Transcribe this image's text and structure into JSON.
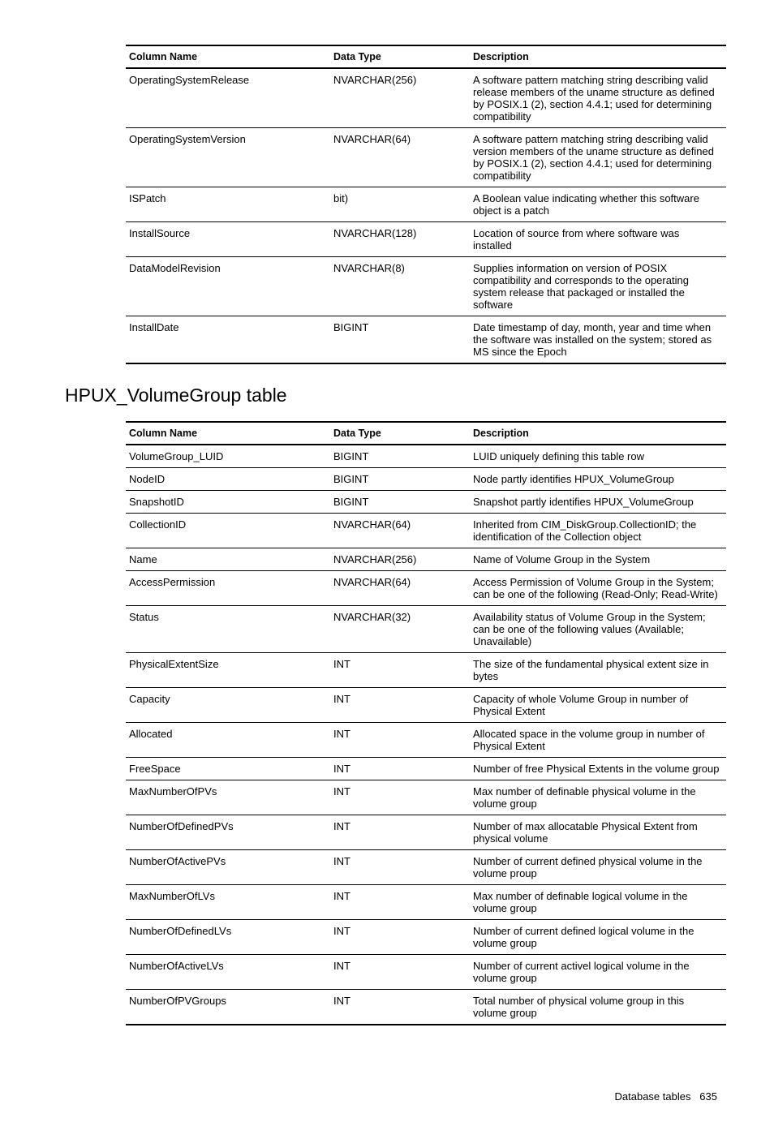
{
  "table1": {
    "headers": {
      "col1": "Column Name",
      "col2": "Data Type",
      "col3": "Description"
    },
    "rows": [
      {
        "name": "OperatingSystemRelease",
        "type": "NVARCHAR(256)",
        "desc": "A software pattern matching string describing valid release members of the uname structure as defined by POSIX.1 (2), section 4.4.1; used for determining compatibility"
      },
      {
        "name": "OperatingSystemVersion",
        "type": "NVARCHAR(64)",
        "desc": "A software pattern matching string describing valid version members of the uname structure as defined by POSIX.1 (2), section 4.4.1; used for determining compatibility"
      },
      {
        "name": "ISPatch",
        "type": "bit)",
        "desc": "A Boolean value indicating whether this software object is a patch"
      },
      {
        "name": "InstallSource",
        "type": "NVARCHAR(128)",
        "desc": "Location of source from where software was installed"
      },
      {
        "name": "DataModelRevision",
        "type": "NVARCHAR(8)",
        "desc": "Supplies information on version of POSIX compatibility and corresponds to the operating system release that packaged or installed the software"
      },
      {
        "name": "InstallDate",
        "type": "BIGINT",
        "desc": "Date timestamp of day, month, year and time when the software was installed on the system; stored as MS since the Epoch"
      }
    ]
  },
  "section_heading": "HPUX_VolumeGroup table",
  "table2": {
    "headers": {
      "col1": "Column Name",
      "col2": "Data Type",
      "col3": "Description"
    },
    "rows": [
      {
        "name": "VolumeGroup_LUID",
        "type": "BIGINT",
        "desc": "LUID uniquely defining this table row"
      },
      {
        "name": "NodeID",
        "type": "BIGINT",
        "desc": "Node partly identifies HPUX_VolumeGroup"
      },
      {
        "name": "SnapshotID",
        "type": "BIGINT",
        "desc": "Snapshot partly identifies HPUX_VolumeGroup"
      },
      {
        "name": "CollectionID",
        "type": "NVARCHAR(64)",
        "desc": "Inherited from CIM_DiskGroup.CollectionID; the identification of the Collection object"
      },
      {
        "name": "Name",
        "type": "NVARCHAR(256)",
        "desc": "Name of Volume Group in the System"
      },
      {
        "name": "AccessPermission",
        "type": "NVARCHAR(64)",
        "desc": "Access Permission of Volume Group in the System; can be one of the following (Read-Only; Read-Write)"
      },
      {
        "name": "Status",
        "type": "NVARCHAR(32)",
        "desc": "Availability status of Volume Group in the System; can be one of the following values (Available; Unavailable)"
      },
      {
        "name": "PhysicalExtentSize",
        "type": "INT",
        "desc": "The size of the fundamental physical extent size in bytes"
      },
      {
        "name": "Capacity",
        "type": "INT",
        "desc": "Capacity of whole Volume Group in number of Physical Extent"
      },
      {
        "name": "Allocated",
        "type": "INT",
        "desc": "Allocated space in the volume group in number of Physical Extent"
      },
      {
        "name": "FreeSpace",
        "type": "INT",
        "desc": "Number of free Physical Extents in the volume group"
      },
      {
        "name": "MaxNumberOfPVs",
        "type": "INT",
        "desc": "Max number of definable physical volume in the volume group"
      },
      {
        "name": "NumberOfDefinedPVs",
        "type": "INT",
        "desc": "Number of max allocatable Physical Extent from physical volume"
      },
      {
        "name": "NumberOfActivePVs",
        "type": "INT",
        "desc": "Number of current defined physical volume in the volume proup"
      },
      {
        "name": "MaxNumberOfLVs",
        "type": "INT",
        "desc": "Max number of definable logical volume in the volume group"
      },
      {
        "name": "NumberOfDefinedLVs",
        "type": "INT",
        "desc": "Number of current defined logical volume in the volume group"
      },
      {
        "name": "NumberOfActiveLVs",
        "type": "INT",
        "desc": "Number of current activel logical volume in the volume group"
      },
      {
        "name": "NumberOfPVGroups",
        "type": "INT",
        "desc": "Total number of physical volume group in this volume group"
      }
    ]
  },
  "footer": {
    "label": "Database tables",
    "page": "635"
  }
}
